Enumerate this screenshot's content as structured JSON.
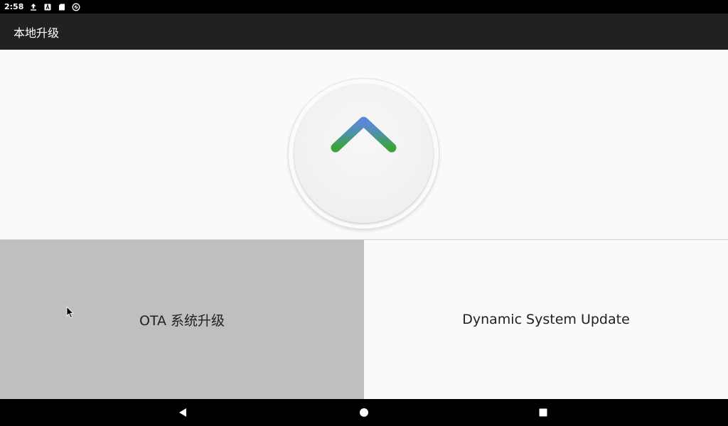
{
  "status_bar": {
    "time": "2:58",
    "icons": [
      "upload-icon",
      "text-a-icon",
      "sd-card-icon",
      "sync-icon"
    ]
  },
  "action_bar": {
    "title": "本地升级"
  },
  "hero": {
    "icon": "arrow-up-icon",
    "arrow_gradient": [
      "#5b86d8",
      "#3aa33a"
    ]
  },
  "options": [
    {
      "label": "OTA 系统升级",
      "state": "pressed"
    },
    {
      "label": "Dynamic System Update",
      "state": "normal"
    }
  ],
  "nav": {
    "buttons": [
      "back-icon",
      "home-icon",
      "recents-icon"
    ]
  },
  "colors": {
    "status_bar_bg": "#000000",
    "action_bar_bg": "#212121",
    "content_bg": "#fafafa",
    "pressed_bg": "#bfbfbf"
  }
}
